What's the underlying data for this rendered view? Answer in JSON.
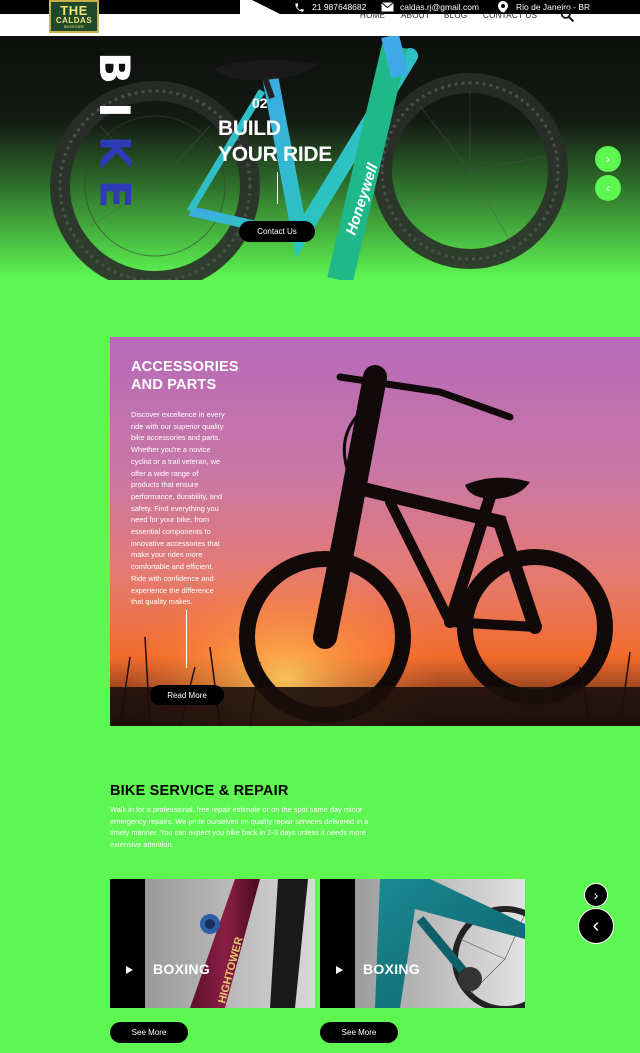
{
  "topbar": {
    "phone": "21 987648682",
    "email": "caldas.rj@gmail.com",
    "location": "Rio de Janeiro - BR"
  },
  "logo": {
    "line1": "THE",
    "line2": "CALDAS",
    "line3": "BIKESTORE"
  },
  "nav": {
    "items": [
      "HOME",
      "ABOUT",
      "BLOG",
      "CONTACT US"
    ]
  },
  "hero": {
    "vertical_word": [
      "B",
      "I",
      "K",
      "E"
    ],
    "slide_number": "02",
    "title_line1": "BUILD",
    "title_line2": "YOUR RIDE",
    "button": "Contact Us",
    "bike_brand": "Honeywell",
    "next_arrow": "›",
    "prev_arrow": "‹"
  },
  "accessories": {
    "title_line1": "ACCESSORIES",
    "title_line2": "AND PARTS",
    "lines": [
      "Discover excellence in every",
      "ride with our superior quality",
      "bike accessories and parts.",
      "Whether you're a novice",
      "cyclist or a trail veteran, we",
      "offer a wide range of",
      "products that ensure",
      "performance, durability, and",
      "safety. Find everything you",
      "need for your bike, from",
      "essential components to",
      "innovative accessories that",
      "make your rides more",
      "comfortable and efficient.",
      "Ride with confidence and",
      "experience the difference",
      "that quality makes."
    ],
    "button": "Read More"
  },
  "service": {
    "title": "BIKE SERVICE & REPAIR",
    "lines": [
      "Walk in for a professional, free repair estimate or on the spot same day minor",
      "emergency repairs. We pride ourselves on quality repair services delivered in a",
      "timely manner. You can expect you bike back in 2-3 days unless it needs more",
      "extensive attention."
    ],
    "cards": [
      {
        "label": "BOXING",
        "frame_text": "HIGHTOWER",
        "button": "See More"
      },
      {
        "label": "BOXING",
        "button": "See More"
      }
    ],
    "next_arrow": "›",
    "prev_arrow": "‹"
  },
  "colors": {
    "accent_green": "#5ef752",
    "black": "#000000",
    "white": "#ffffff",
    "bike_word": "#2d3bb5"
  }
}
